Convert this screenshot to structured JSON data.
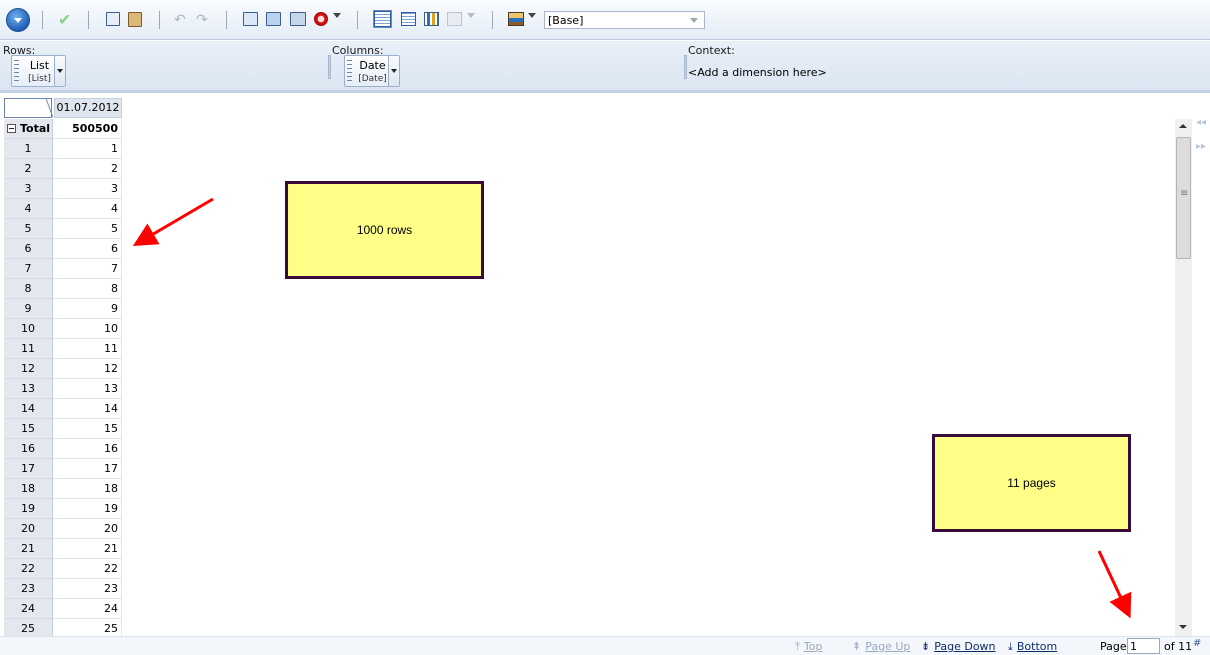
{
  "toolbar": {
    "perspective_select": "[Base]",
    "icons": [
      "menu-icon",
      "apply-check-icon",
      "copy-icon",
      "paste-icon",
      "undo-icon",
      "redo-icon",
      "open-view-icon",
      "save-view-icon",
      "settings-icon",
      "stop-icon",
      "grid-view-icon",
      "table-view-icon",
      "chart-view-icon",
      "chart-options-icon",
      "palette-icon"
    ]
  },
  "dimensions": {
    "rows_label": "Rows:",
    "rows_chip": {
      "name": "List",
      "sub": "[List]"
    },
    "columns_label": "Columns:",
    "columns_chip": {
      "name": "Date",
      "sub": "[Date]"
    },
    "context_label": "Context:",
    "context_hint": "<Add a dimension here>"
  },
  "grid": {
    "column_header": "01.07.2012",
    "total_label": "Total",
    "total_value": "500500",
    "rows": [
      {
        "label": "1",
        "value": "1"
      },
      {
        "label": "2",
        "value": "2"
      },
      {
        "label": "3",
        "value": "3"
      },
      {
        "label": "4",
        "value": "4"
      },
      {
        "label": "5",
        "value": "5"
      },
      {
        "label": "6",
        "value": "6"
      },
      {
        "label": "7",
        "value": "7"
      },
      {
        "label": "8",
        "value": "8"
      },
      {
        "label": "9",
        "value": "9"
      },
      {
        "label": "10",
        "value": "10"
      },
      {
        "label": "11",
        "value": "11"
      },
      {
        "label": "12",
        "value": "12"
      },
      {
        "label": "13",
        "value": "13"
      },
      {
        "label": "14",
        "value": "14"
      },
      {
        "label": "15",
        "value": "15"
      },
      {
        "label": "16",
        "value": "16"
      },
      {
        "label": "17",
        "value": "17"
      },
      {
        "label": "18",
        "value": "18"
      },
      {
        "label": "19",
        "value": "19"
      },
      {
        "label": "20",
        "value": "20"
      },
      {
        "label": "21",
        "value": "21"
      },
      {
        "label": "22",
        "value": "22"
      },
      {
        "label": "23",
        "value": "23"
      },
      {
        "label": "24",
        "value": "24"
      },
      {
        "label": "25",
        "value": "25"
      }
    ]
  },
  "annotations": {
    "note_rows": "1000 rows",
    "note_pages": "11 pages",
    "note_fill": "#ffff88",
    "arrow_color": "#ff0000"
  },
  "pager": {
    "top": "Top",
    "page_up": "Page Up",
    "page_down": "Page Down",
    "bottom": "Bottom",
    "page_label": "Page",
    "page_value": "1",
    "page_of": "of 11"
  }
}
